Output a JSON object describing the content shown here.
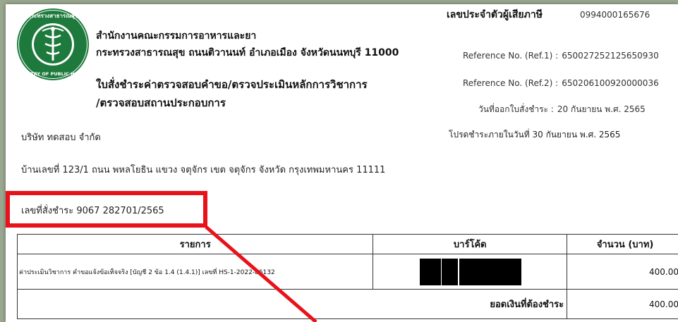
{
  "header": {
    "agency_line1": "สำนักงานคณะกรรมการอาหารและยา",
    "agency_line2": "กระทรวงสาธารณสุข ถนนติวานนท์ อำเภอเมือง จังหวัดนนทบุรี 11000",
    "doc_title_line1": "ใบสั่งชำระค่าตรวจสอบคำขอ/ตรวจประเมินหลักการวิชาการ",
    "doc_title_line2": "/ตรวจสอบสถานประกอบการ"
  },
  "emblem": {
    "text_top": "กระทรวงสาธารณสุข",
    "text_bottom": "MINISTRY OF PUBLIC HEALTH",
    "color": "#1e7a3c"
  },
  "right_info": {
    "tax_id_label": "เลขประจำตัวผู้เสียภาษี",
    "tax_id_value": "0994000165676",
    "ref1_label": "Reference No. (Ref.1) :",
    "ref1_value": "650027252125650930",
    "ref2_label": "Reference No. (Ref.2) :",
    "ref2_value": "650206100920000036",
    "issue_label": "วันที่ออกใบสั่งชำระ :",
    "issue_value": "20 กันยายน พ.ศ. 2565",
    "due_text": "โปรดชำระภายในวันที่ 30 กันยายน พ.ศ. 2565"
  },
  "company": "บริษัท ทดสอบ จำกัด",
  "address": "บ้านเลขที่ 123/1 ถนน พหลโยธิน แขวง จตุจักร เขต จตุจักร จังหวัด กรุงเทพมหานคร 11111",
  "payment_no": "เลขที่สั่งชำระ 9067 282701/2565",
  "table": {
    "headers": [
      "รายการ",
      "บาร์โค้ด",
      "จำนวน (บาท)"
    ],
    "rows": [
      {
        "description": "ค่าประเมินวิชาการ คำขอแจ้งข้อเท็จจริง [บัญชี 2 ข้อ 1.4 (1.4.1)] เลขที่ HS-1-2022-86132",
        "amount": "400.00"
      }
    ],
    "total_label": "ยอดเงินที่ต้องชำระ",
    "total_amount": "400.00"
  },
  "annotation": {
    "color": "#e8121a"
  }
}
